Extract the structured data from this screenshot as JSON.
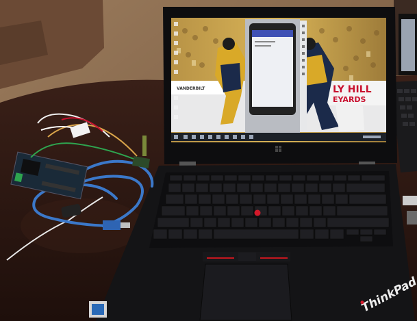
{
  "scene": {
    "description_label": "Photo of a laptop on a wooden table next to a breadboard-connected microcontroller",
    "colors": {
      "floor": "#8a6a4c",
      "table": "#2b1711",
      "laptop_body": "#141416",
      "screen_bg": "#d7b45a",
      "phone_screen": "#eef0f4",
      "usb_cable": "#3b78c9",
      "trackpoint": "#d3192a",
      "taskbar": "#1c2128"
    },
    "screen": {
      "banner_left": "VANDERBILT",
      "banner_right_line1": "LY HILL",
      "banner_right_line2": "EYARDS"
    },
    "laptop": {
      "brand": "ThinkPad"
    }
  }
}
